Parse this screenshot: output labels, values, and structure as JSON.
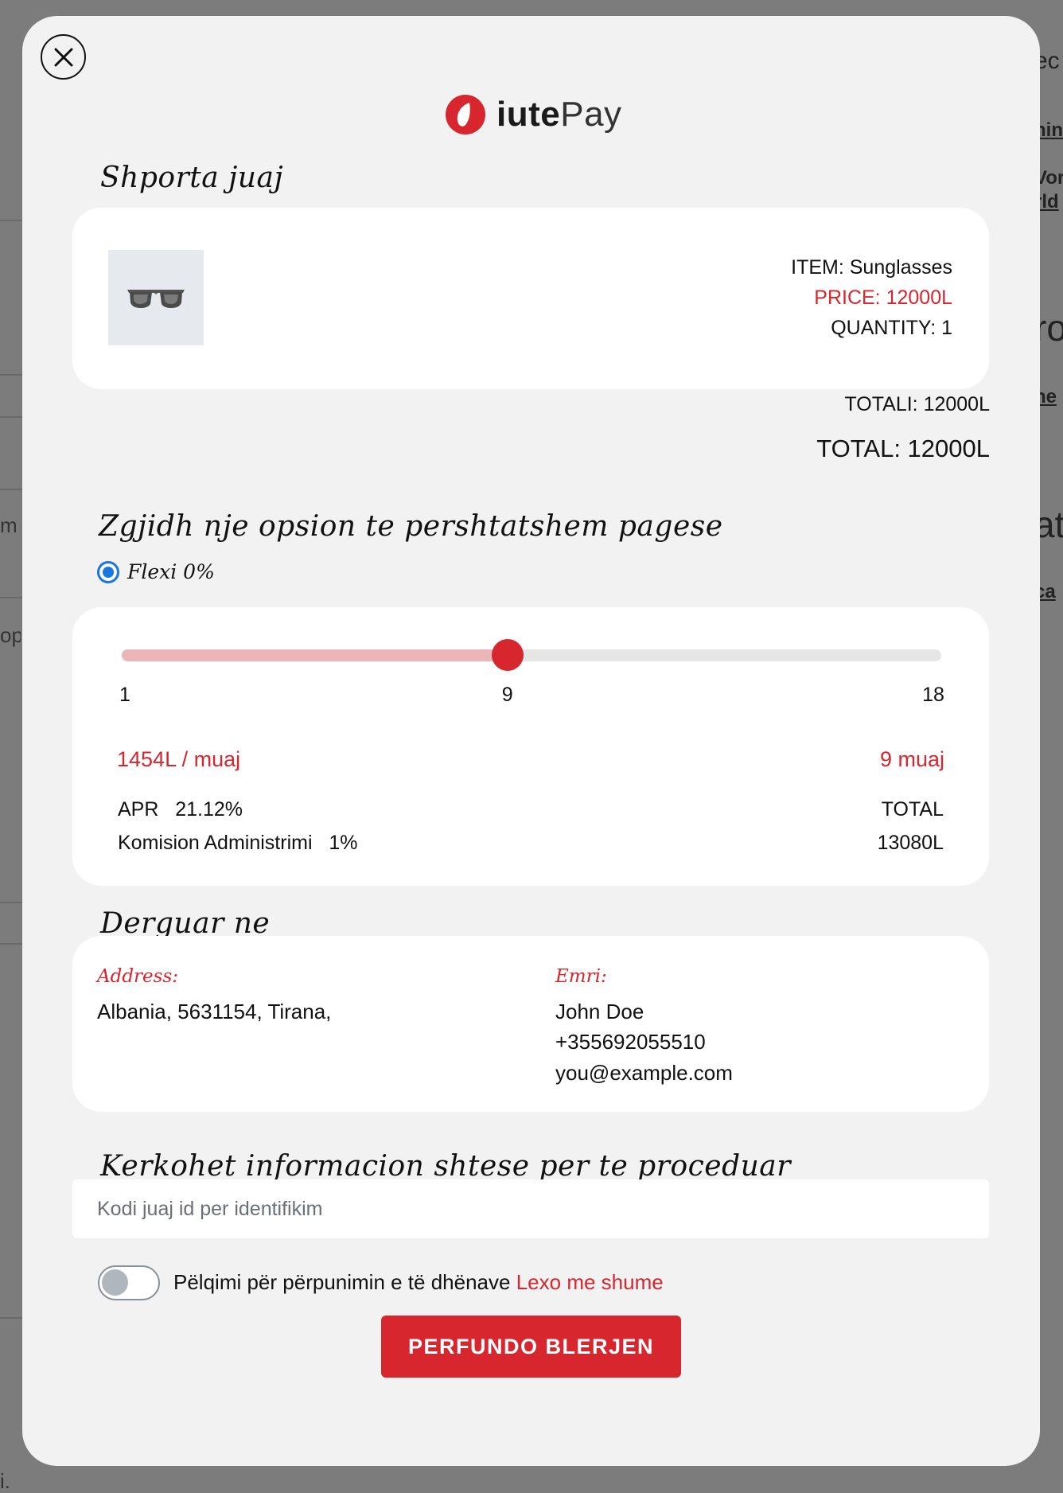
{
  "background": {
    "right_fragments": [
      "ec",
      "nin",
      "Vor",
      "rld",
      "ro",
      "ne",
      "at",
      "ca"
    ],
    "left_fragments": [
      "m",
      "op",
      "i."
    ]
  },
  "modal": {
    "close_icon": "close-icon",
    "logo": {
      "bold": "iute",
      "light": "Pay"
    },
    "cart": {
      "heading": "Shporta juaj",
      "item_line": "ITEM: Sunglasses",
      "price_line": "PRICE: 12000L",
      "quantity_line": "QUANTITY: 1",
      "totali_line": "TOTALI: 12000L",
      "total_line": "TOTAL: 12000L"
    },
    "payment": {
      "heading": "Zgjidh nje opsion te pershtatshem pagese",
      "option_label": "Flexi 0%",
      "slider": {
        "min": 1,
        "max": 18,
        "value": 9
      },
      "tick_min": "1",
      "tick_mid": "9",
      "tick_max": "18",
      "monthly": "1454L / muaj",
      "months": "9 muaj",
      "apr_label": "APR",
      "apr_value": "21.12%",
      "commission_label": "Komision Administrimi",
      "commission_value": "1%",
      "total_label": "TOTAL",
      "total_value": "13080L"
    },
    "shipping": {
      "heading": "Derguar ne",
      "address_label": "Address:",
      "address_value": "Albania,  5631154,  Tirana,",
      "name_label": "Emri:",
      "name_value": "John Doe",
      "phone": "+355692055510",
      "email": "you@example.com"
    },
    "extra": {
      "heading": "Kerkohet informacion shtese per te proceduar",
      "id_placeholder": "Kodi juaj id per identifikim",
      "id_value": ""
    },
    "consent": {
      "text": "Pëlqimi për përpunimin e të dhënave",
      "link": "Lexo me shume",
      "checked": false
    },
    "submit_label": "PERFUNDO BLERJEN"
  },
  "colors": {
    "accent": "#d7262e",
    "accent_light": "#ecb6b8",
    "radio": "#1976e0",
    "modal_bg": "#f2f2f2",
    "overlay": "#7c7c7c"
  }
}
